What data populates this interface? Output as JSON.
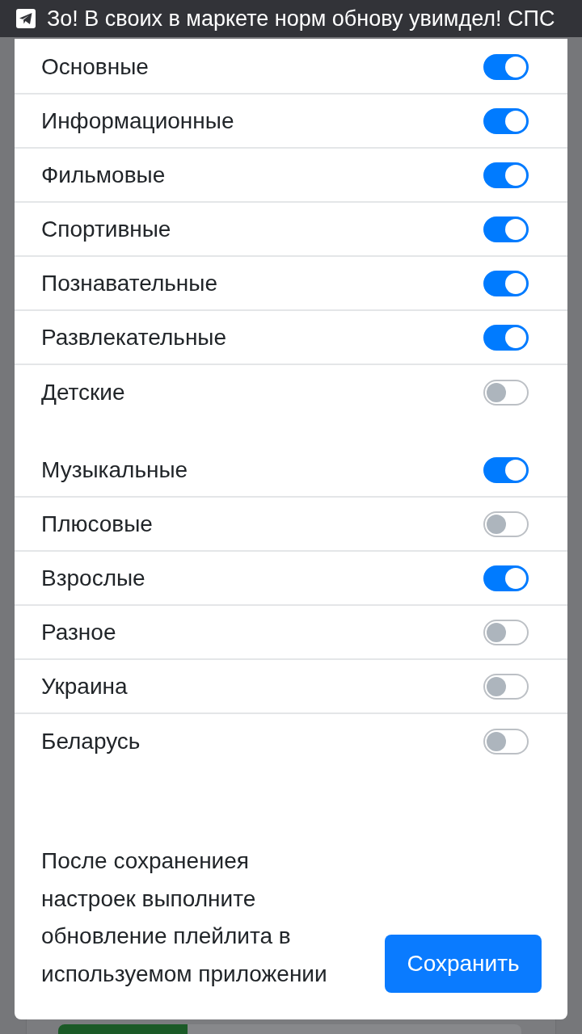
{
  "status_bar": {
    "notification_text": "Зо! В своих в маркете норм обнову увимдел! СПС"
  },
  "groups": [
    {
      "items": [
        {
          "label": "Основные",
          "on": true
        },
        {
          "label": "Информационные",
          "on": true
        },
        {
          "label": "Фильмовые",
          "on": true
        },
        {
          "label": "Спортивные",
          "on": true
        },
        {
          "label": "Познавательные",
          "on": true
        },
        {
          "label": "Развлекательные",
          "on": true
        },
        {
          "label": "Детские",
          "on": false
        }
      ]
    },
    {
      "items": [
        {
          "label": "Музыкальные",
          "on": true
        },
        {
          "label": "Плюсовые",
          "on": false
        },
        {
          "label": "Взрослые",
          "on": true
        },
        {
          "label": "Разное",
          "on": false
        },
        {
          "label": "Украина",
          "on": false
        },
        {
          "label": "Беларусь",
          "on": false
        }
      ]
    }
  ],
  "footer": {
    "note": "После сохранениея\nнастроек выполните\nобновление плейлита в\nиспользуемом приложении",
    "save_button": "Сохранить"
  },
  "background": {
    "progress_bar": {
      "level": 0.28
    }
  }
}
